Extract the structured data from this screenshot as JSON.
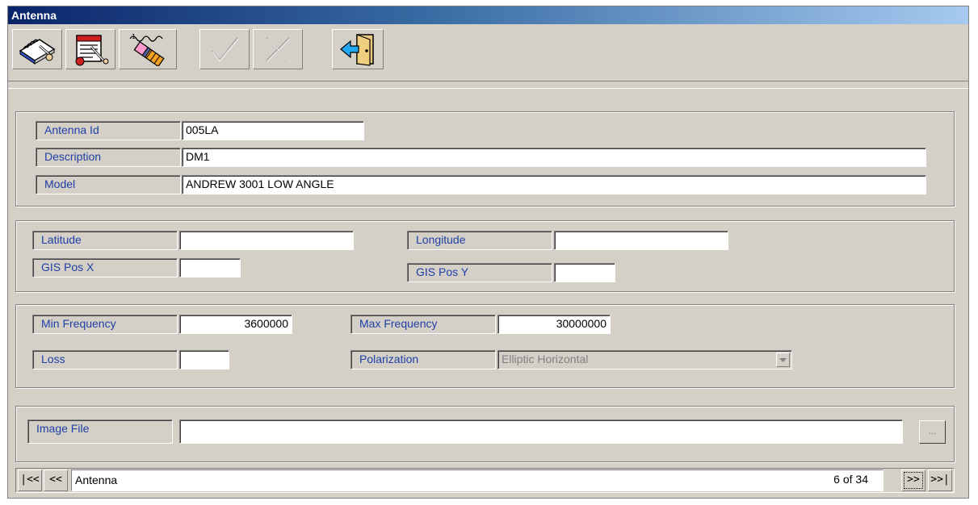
{
  "window": {
    "title": "Antenna"
  },
  "toolbar": {
    "buttons": [
      {
        "icon": "notebook-edit-icon",
        "enabled": true
      },
      {
        "icon": "notebook-new-icon",
        "enabled": true
      },
      {
        "icon": "eraser-icon",
        "enabled": true
      },
      {
        "icon": "checkmark-icon",
        "enabled": false
      },
      {
        "icon": "cross-icon",
        "enabled": false
      },
      {
        "icon": "exit-door-icon",
        "enabled": true
      }
    ]
  },
  "identity": {
    "antenna_id_label": "Antenna Id",
    "antenna_id_value": "005LA",
    "description_label": "Description",
    "description_value": "DM1",
    "model_label": "Model",
    "model_value": "ANDREW 3001 LOW ANGLE"
  },
  "location": {
    "latitude_label": "Latitude",
    "latitude_value": "",
    "longitude_label": "Longitude",
    "longitude_value": "",
    "gis_x_label": "GIS Pos X",
    "gis_x_value": "",
    "gis_y_label": "GIS Pos Y",
    "gis_y_value": ""
  },
  "frequency": {
    "min_label": "Min Frequency",
    "min_value": "3600000",
    "max_label": "Max Frequency",
    "max_value": "30000000",
    "loss_label": "Loss",
    "loss_value": "",
    "polarization_label": "Polarization",
    "polarization_value": "Elliptic Horizontal"
  },
  "image": {
    "label": "Image File",
    "value": "",
    "browse_label": "..."
  },
  "navigator": {
    "first_label": "|<<",
    "prev_label": "<<",
    "record_label": "Antenna",
    "position": "6 of 34",
    "next_label": ">>",
    "last_label": ">>|"
  },
  "colors": {
    "face": "#d4d0c8",
    "label_text": "#1f3fa6",
    "title_start": "#0a246a",
    "title_end": "#a6caf0"
  }
}
